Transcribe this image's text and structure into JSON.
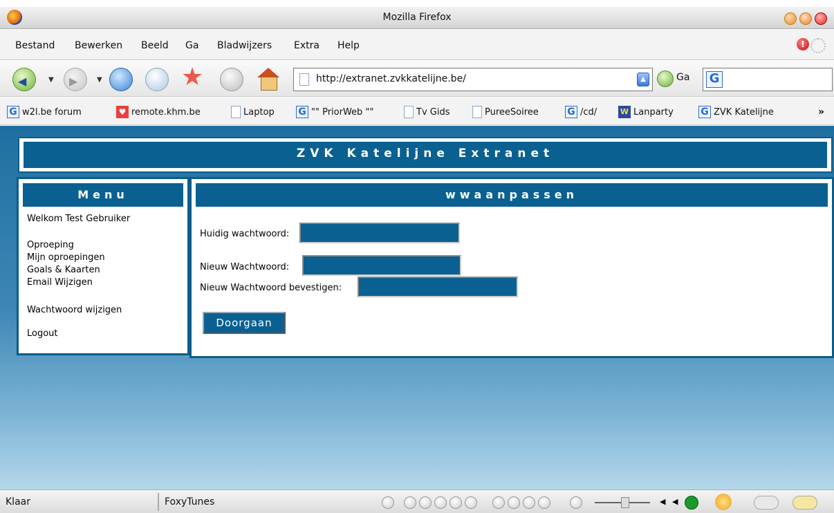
{
  "window": {
    "title": "Mozilla Firefox"
  },
  "menubar": [
    "Bestand",
    "Bewerken",
    "Beeld",
    "Ga",
    "Bladwijzers",
    "Extra",
    "Help"
  ],
  "navbar": {
    "url": "http://extranet.zvkkatelijne.be/",
    "go_label": "Ga"
  },
  "bookmarks": [
    {
      "label": "w2l.be forum",
      "icon": "google-icon"
    },
    {
      "label": "remote.khm.be",
      "icon": "red-icon"
    },
    {
      "label": "Laptop",
      "icon": "page-icon"
    },
    {
      "label": "\"\" PriorWeb \"\"",
      "icon": "google-icon"
    },
    {
      "label": "Tv Gids",
      "icon": "page-icon"
    },
    {
      "label": "PureeSoiree",
      "icon": "page-icon"
    },
    {
      "label": "/cd/",
      "icon": "google-icon"
    },
    {
      "label": "Lanparty",
      "icon": "w-icon"
    },
    {
      "label": "ZVK Katelijne",
      "icon": "google-icon"
    }
  ],
  "page": {
    "site_title": "ZVK Katelijne Extranet",
    "menu": {
      "title": "Menu",
      "welcome": "Welkom Test Gebruiker",
      "links": [
        "Oproeping",
        "Mijn oproepingen",
        "Goals & Kaarten",
        "Email Wijzigen",
        "Wachtwoord wijzigen",
        "Logout"
      ]
    },
    "form": {
      "title": "wwaanpassen",
      "current_label": "Huidig wachtwoord:",
      "new_label": "Nieuw Wachtwoord:",
      "confirm_label": "Nieuw Wachtwoord bevestigen:",
      "submit_label": "Doorgaan"
    }
  },
  "status": {
    "text": "Klaar",
    "foxytunes": "FoxyTunes"
  }
}
